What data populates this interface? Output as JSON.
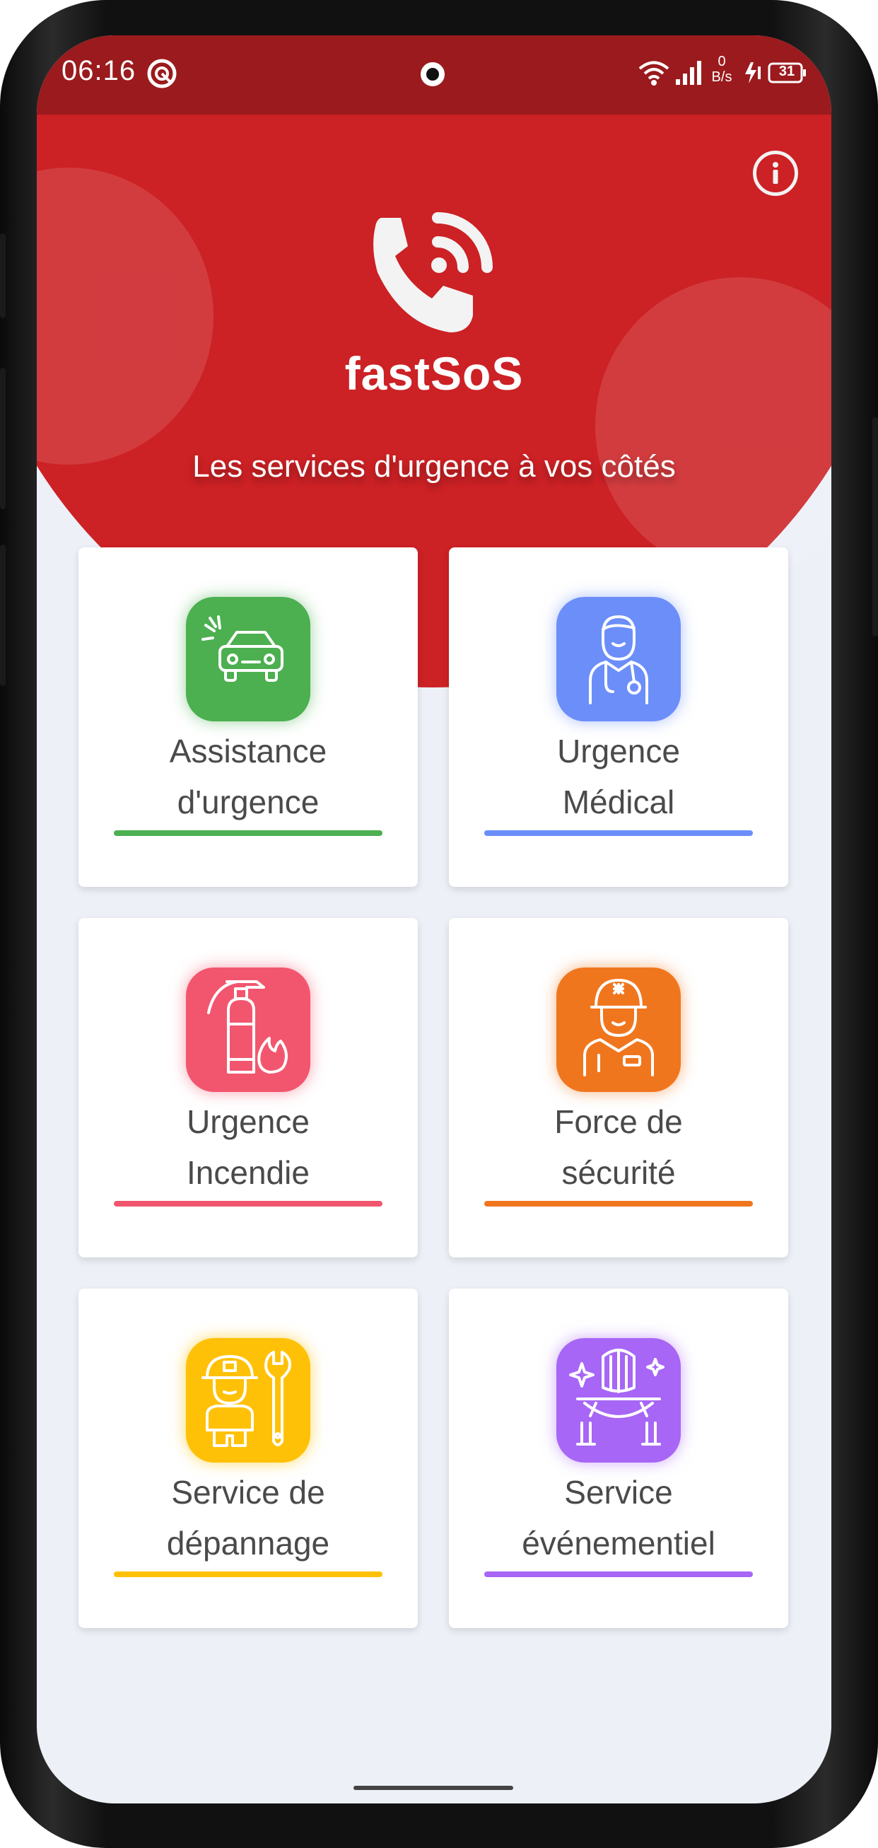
{
  "status_bar": {
    "time": "06:16",
    "net_speed_value": "0",
    "net_speed_unit": "B/s",
    "battery": "31",
    "icons": [
      "focus-mode-icon",
      "wifi-icon",
      "signal-icon",
      "charging-icon",
      "battery-icon"
    ]
  },
  "header": {
    "app_name": "fastSoS",
    "tagline": "Les services d'urgence à vos côtés",
    "logo_icon": "phone-waves-icon",
    "info_icon": "info-icon",
    "header_color": "#cc2125",
    "status_color": "#9a1a1d"
  },
  "services": [
    {
      "line1": "Assistance",
      "line2": "d'urgence",
      "color": "#4caf50",
      "icon": "car-crash-icon"
    },
    {
      "line1": "Urgence",
      "line2": "Médical",
      "color": "#6b8ef9",
      "icon": "doctor-icon"
    },
    {
      "line1": "Urgence",
      "line2": "Incendie",
      "color": "#f2566e",
      "icon": "fire-extinguisher-icon"
    },
    {
      "line1": "Force de",
      "line2": "sécurité",
      "color": "#f0761e",
      "icon": "police-officer-icon"
    },
    {
      "line1": "Service de",
      "line2": "dépannage",
      "color": "#ffc107",
      "icon": "mechanic-icon"
    },
    {
      "line1": "Service",
      "line2": "événementiel",
      "color": "#a766f5",
      "icon": "event-stage-icon"
    }
  ]
}
